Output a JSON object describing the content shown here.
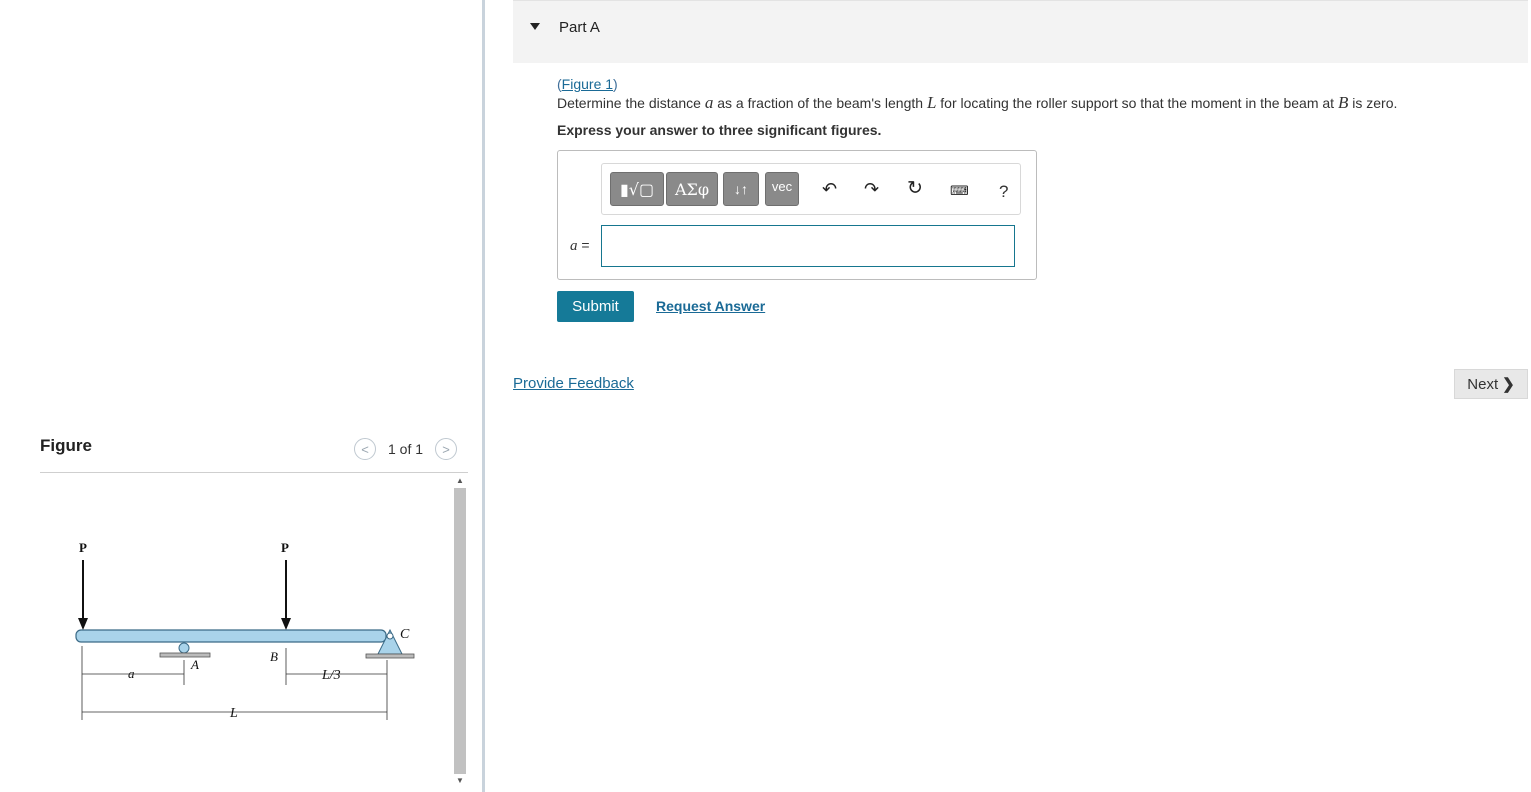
{
  "figure_panel": {
    "title": "Figure",
    "pager_text": "1 of 1",
    "prev_icon": "chevron-left-icon",
    "next_icon": "chevron-right-icon",
    "diagram_labels": {
      "load_left": "P",
      "load_mid": "P",
      "support_a": "A",
      "point_b": "B",
      "support_c": "C",
      "dim_a": "a",
      "dim_l3": "L/3",
      "dim_l": "L"
    }
  },
  "part": {
    "title": "Part A",
    "figure_link": "Figure 1",
    "question_prefix": "Determine the distance ",
    "question_var_a": "a",
    "question_mid": " as a fraction of the beam's length ",
    "question_var_l": "L",
    "question_mid2": " for locating the roller support so that the moment in the beam at ",
    "question_var_b": "B",
    "question_suffix": " is zero.",
    "instruction": "Express your answer to three significant figures."
  },
  "toolbar": {
    "template_label": "▮√▢",
    "greek_label": "ΑΣφ",
    "arrows_label": "↓↑",
    "vec_label": "vec",
    "undo_icon": "undo-icon",
    "redo_icon": "redo-icon",
    "reset_icon": "reset-icon",
    "keyboard_icon": "keyboard-icon",
    "help_label": "?"
  },
  "answer": {
    "variable": "a",
    "equals": " =",
    "value": ""
  },
  "actions": {
    "submit_label": "Submit",
    "request_answer_label": "Request Answer",
    "feedback_label": "Provide Feedback",
    "next_label": "Next"
  },
  "colors": {
    "accent": "#157a98",
    "link": "#1a6a96",
    "beam_fill": "#a9d3ea",
    "beam_stroke": "#3b6a86"
  }
}
